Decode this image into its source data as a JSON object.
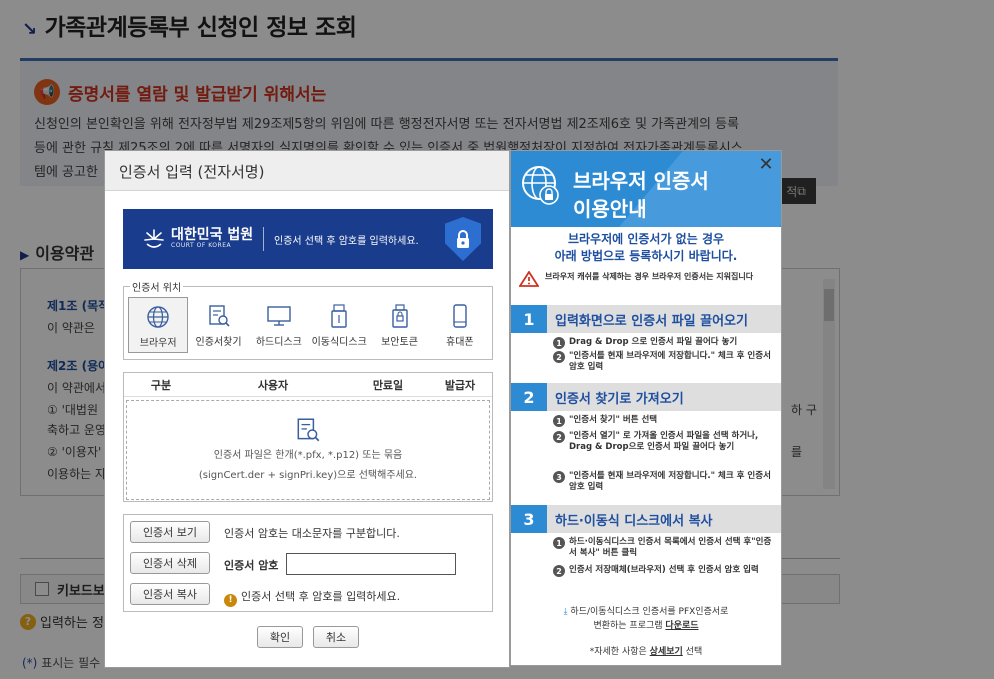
{
  "page": {
    "title": "가족관계등록부 신청인 정보 조회",
    "notice": {
      "heading": "증명서를 열람 및 발급받기 위해서는",
      "lines": [
        "신청인의 본인확인을 위해 전자정부법 제29조제5항의 위임에 따른 행정전자서명 또는 전자서명법 제2조제6호 및 가족관계의 등록",
        "등에 관한 규칙 제25조의 2에 따른 서명자의 실지명의를 확인할 수 있는 인증서 중 법원행정처장이 지정하여 전자가족관계등록시스",
        "템에 공고한"
      ],
      "side_button": "적"
    },
    "terms": {
      "section": "이용약관",
      "lines": [
        "제1조 (목적",
        "이 약관은",
        "제2조 (용어",
        "이 약관에서",
        "① '대법원",
        "축하고 운영",
        "② '이용자'",
        "이용하는 자"
      ],
      "right_fragments": [
        "하 구",
        "를"
      ]
    },
    "keyboard_label": "키보드보",
    "help_text": "입력하는 정",
    "required_note_star": "(*)",
    "required_note": "표시는 필수"
  },
  "dialog": {
    "title": "인증서 입력 (전자서명)",
    "banner": {
      "org_name": "대한민국 법원",
      "org_sub": "COURT OF KOREA",
      "message": "인증서 선택 후 암호를 입력하세요."
    },
    "location_legend": "인증서 위치",
    "locations": [
      {
        "label": "브라우저",
        "icon": "globe-lock-icon",
        "active": true
      },
      {
        "label": "인증서찾기",
        "icon": "cert-search-icon",
        "active": false
      },
      {
        "label": "하드디스크",
        "icon": "monitor-icon",
        "active": false
      },
      {
        "label": "이동식디스크",
        "icon": "usb-icon",
        "active": false
      },
      {
        "label": "보안토큰",
        "icon": "token-icon",
        "active": false
      },
      {
        "label": "휴대폰",
        "icon": "phone-icon",
        "active": false
      }
    ],
    "table_headers": [
      "구분",
      "사용자",
      "만료일",
      "발급자"
    ],
    "drop_text_1": "인증서 파일은 한개(*.pfx, *.p12) 또는 묶음",
    "drop_text_2": "(signCert.der + signPri.key)으로 선택해주세요.",
    "view_button": "인증서 보기",
    "case_note": "인증서 암호는 대소문자를 구분합니다.",
    "delete_button": "인증서 삭제",
    "password_label": "인증서 암호",
    "password_value": "",
    "copy_button": "인증서 복사",
    "hint": "인증서 선택 후 암호를 입력하세요.",
    "ok_button": "확인",
    "cancel_button": "취소"
  },
  "guide": {
    "title_line1": "브라우저 인증서",
    "title_line2": "이용안내",
    "close": "✕",
    "subtitle_line1": "브라우저에 인증서가 없는 경우",
    "subtitle_line2": "아래 방법으로 등록하시기 바랍니다.",
    "warning": "브라우저 캐쉬를 삭제하는 경우 브라우저 인증서는 지워집니다",
    "steps": [
      {
        "num": "1",
        "title": "입력화면으로 인증서 파일 끌어오기",
        "items": [
          "Drag & Drop 으로 인증서 파일 끌어다 놓기",
          "\"인증서를 현재 브라우저에 저장합니다.\" 체크 후 인증서 암호 입력"
        ]
      },
      {
        "num": "2",
        "title": "인증서 찾기로 가져오기",
        "items": [
          "\"인증서 찾기\" 버튼 선택",
          "\"인증서 열기\" 로 가져올 인증서 파일을 선택 하거나, Drag & Drop으로 인증서 파일 끌어다 놓기",
          "\"인증서를 현재 브라우저에 저장합니다.\" 체크 후 인증서 암호 입력"
        ]
      },
      {
        "num": "3",
        "title": "하드·이동식 디스크에서 복사",
        "items": [
          "하드·이동식디스크 인증서 목록에서 인증서 선택 후\"인증서 복사\" 버튼 클릭",
          "인증서 저장매체(브라우저) 선택 후 인증서 암호 입력"
        ]
      }
    ],
    "footer_line1": "하드/이동식디스크 인증서를 PFX인증서로",
    "footer_line2_prefix": "변환하는 프로그램",
    "footer_download": "다운로드",
    "footer_line3_prefix": "*자세한 사항은",
    "footer_detail": "상세보기",
    "footer_line3_suffix": "선택"
  }
}
